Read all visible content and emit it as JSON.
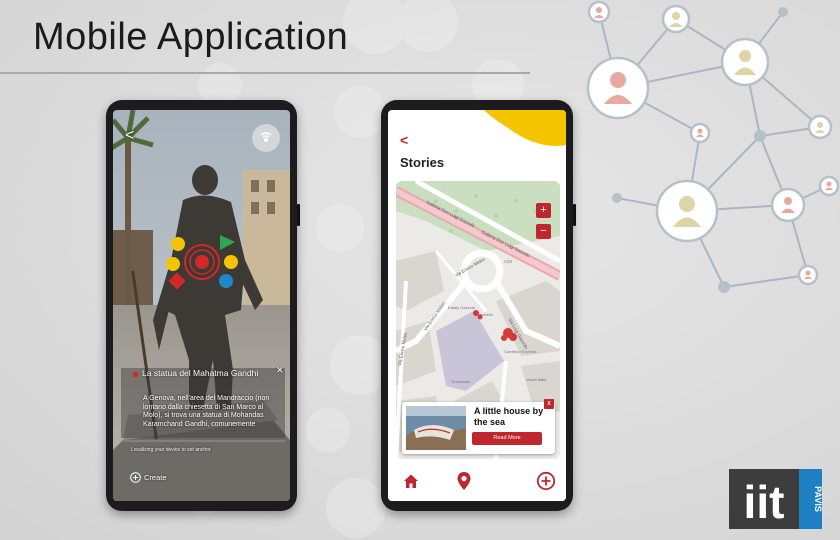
{
  "slide": {
    "title": "Mobile Application"
  },
  "colors": {
    "accent_red": "#c0262d",
    "accent_yellow": "#f5c400",
    "logo_dark": "#3d3d3d",
    "logo_blue": "#1e7fc2"
  },
  "ar_app": {
    "back_glyph": "<",
    "poi_title": "La statua del Mahatma Gandhi",
    "close_glyph": "✕",
    "poi_description": "A Genova, nell'area del Mandraccio (non lontano dalla chiesetta di San Marco al Molo), si trova una statua di Mohandas Karamchand Gandhi, comunemente",
    "status_text": "Localizing your device to set anchor",
    "create_label": "Create"
  },
  "stories_app": {
    "back_glyph": "<",
    "title": "Stories",
    "map": {
      "zoom_in": "+",
      "zoom_out": "−",
      "street_labels": [
        "Galleria Don Luigi Gazzolo",
        "Galleria Don Luigi Gazzolo",
        "A10",
        "Via Enrico Melen",
        "Via Enrico Melen",
        "Via Luigi Gazzolo",
        "Via Enrico Melen"
      ],
      "poi_labels": [
        "Eataly Gazzolo",
        "Carrefour Express",
        "Tronchetto",
        "Tronchetto",
        "Vivaio Italia"
      ]
    },
    "story_card": {
      "title": "A little house by the sea",
      "read_more": "Read More",
      "close_glyph": "x"
    },
    "nav": [
      "home-icon",
      "location-pin-icon",
      "add-circle-icon"
    ]
  },
  "logo": {
    "main": "iit",
    "side": "PAVIS"
  }
}
